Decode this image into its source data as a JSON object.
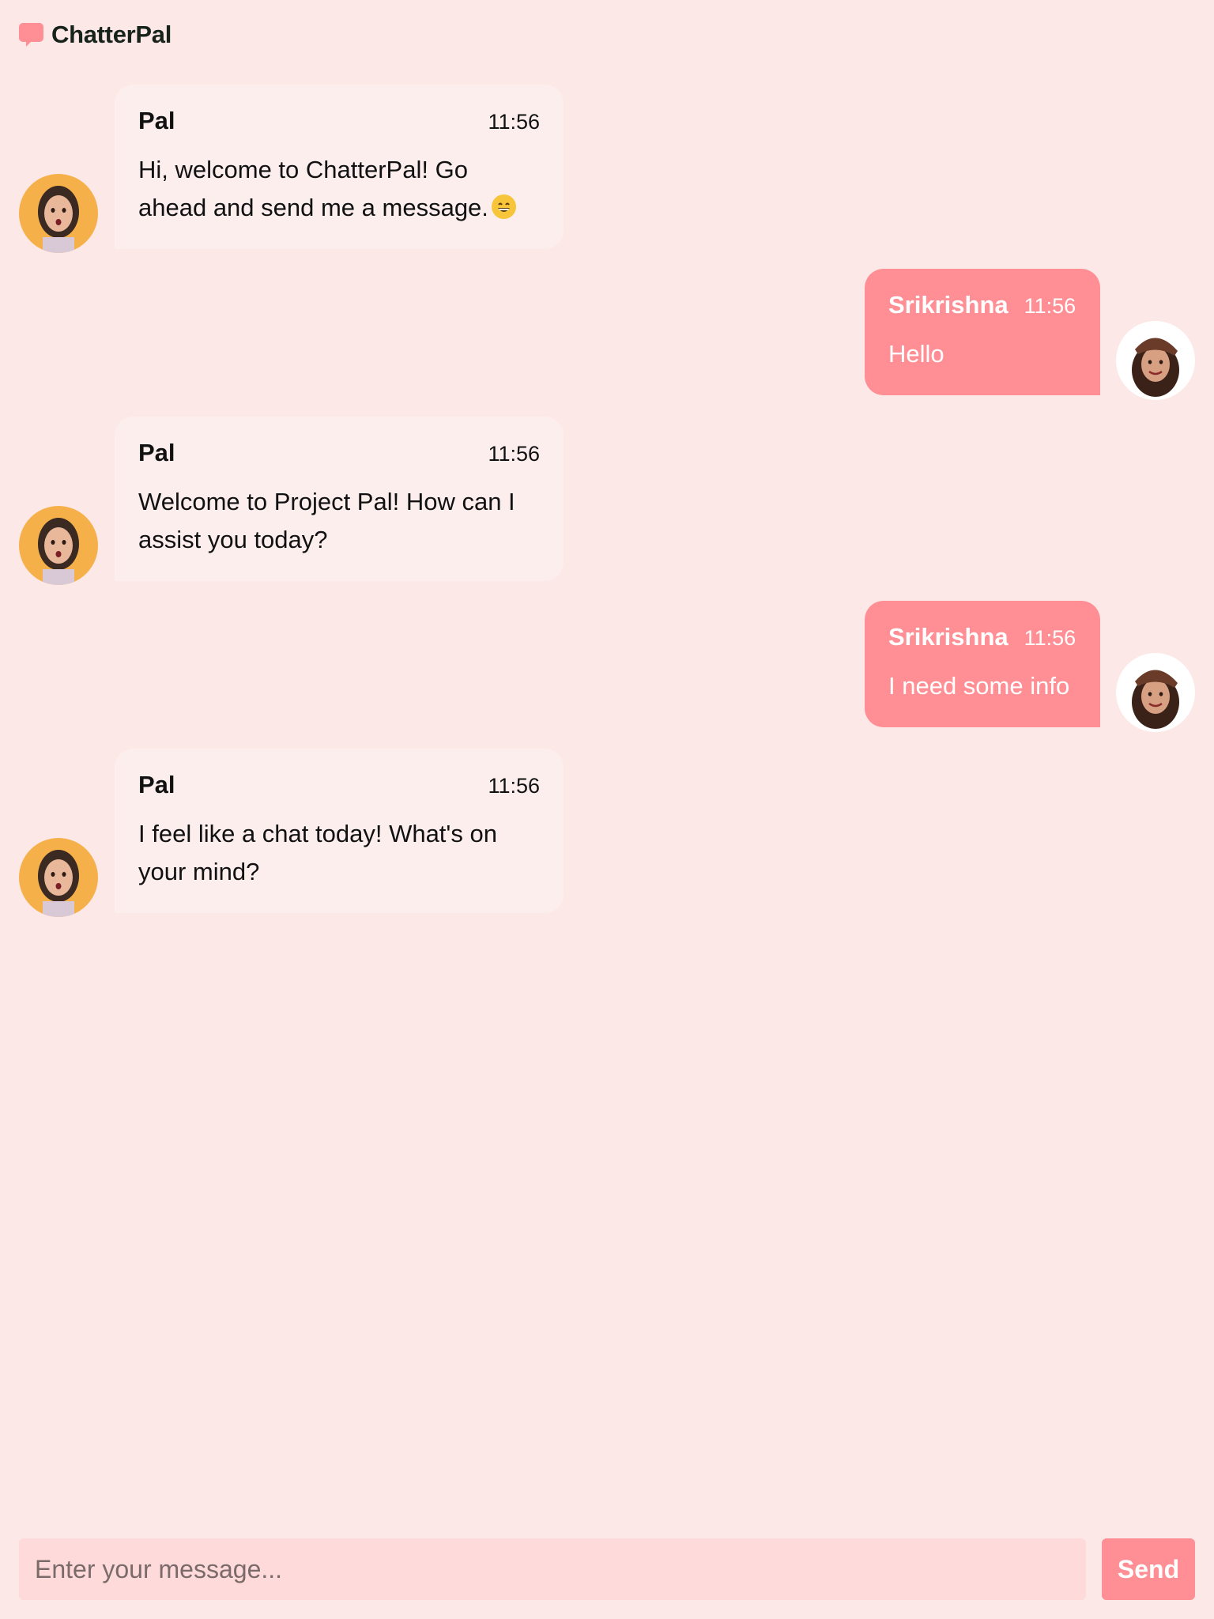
{
  "app": {
    "name": "ChatterPal",
    "logo_icon": "chat-bubble-icon",
    "accent_color": "#ff8f94",
    "background_color": "#fde8e8"
  },
  "messages": [
    {
      "sender": "Pal",
      "time": "11:56",
      "text": "Hi, welcome to ChatterPal! Go ahead and send me a message.",
      "emoji": "grinning-face-emoji",
      "from": "bot"
    },
    {
      "sender": "Srikrishna",
      "time": "11:56",
      "text": "Hello",
      "from": "user"
    },
    {
      "sender": "Pal",
      "time": "11:56",
      "text": "Welcome to Project Pal! How can I assist you today?",
      "from": "bot"
    },
    {
      "sender": "Srikrishna",
      "time": "11:56",
      "text": "I need some info",
      "from": "user"
    },
    {
      "sender": "Pal",
      "time": "11:56",
      "text": "I feel like a chat today! What's on your mind?",
      "from": "bot"
    }
  ],
  "composer": {
    "placeholder": "Enter your message...",
    "value": "",
    "send_label": "Send"
  }
}
